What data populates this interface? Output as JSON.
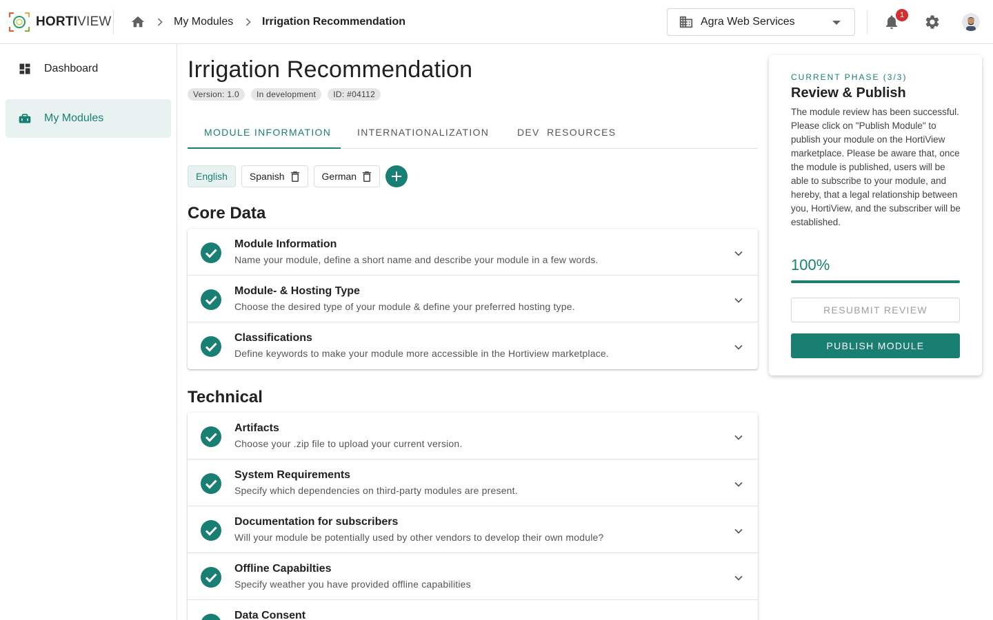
{
  "colors": {
    "accent": "#1a7f73",
    "badge": "#d32f2f"
  },
  "app": {
    "logo_bold": "HORTI",
    "logo_light": "VIEW"
  },
  "breadcrumb": {
    "items": [
      "My Modules",
      "Irrigation Recommendation"
    ]
  },
  "org": {
    "name": "Agra Web Services"
  },
  "notifications": {
    "count": "1"
  },
  "sidebar": {
    "items": [
      {
        "label": "Dashboard",
        "icon": "dashboard-icon"
      },
      {
        "label": "My Modules",
        "icon": "toolbox-icon"
      }
    ]
  },
  "module": {
    "title": "Irrigation Recommendation",
    "version": "Version: 1.0",
    "status": "In development",
    "id": "ID: #04112"
  },
  "tabs": [
    "MODULE INFORMATION",
    "INTERNATIONALIZATION",
    "DEV  RESOURCES"
  ],
  "languages": [
    "English",
    "Spanish",
    "German"
  ],
  "sections": {
    "core": {
      "title": "Core Data",
      "rows": [
        {
          "title": "Module Information",
          "desc": "Name your module, define a short name and describe your module in a few words."
        },
        {
          "title": "Module- & Hosting Type",
          "desc": "Choose the desired type of your module & define your preferred hosting type."
        },
        {
          "title": "Classifications",
          "desc": "Define keywords to make your module more accessible in the Hortiview marketplace."
        }
      ]
    },
    "technical": {
      "title": "Technical",
      "rows": [
        {
          "title": "Artifacts",
          "desc": "Choose your .zip file to upload your current version."
        },
        {
          "title": "System Requirements",
          "desc": "Specify which dependencies on third-party modules are present."
        },
        {
          "title": "Documentation for subscribers",
          "desc": "Will your module be potentially used by other vendors to develop their own module?"
        },
        {
          "title": "Offline Capabilties",
          "desc": "Specify weather you have provided offline capabilities"
        },
        {
          "title": "Data Consent",
          "desc": ""
        }
      ]
    }
  },
  "phase": {
    "label": "CURRENT PHASE (3/3)",
    "title": "Review & Publish",
    "description": "The module review has been successful. Please click on \"Publish Module\" to publish your module on the HortiView marketplace. Please be aware that, once the module is published, users will be able to subscribe to your module, and hereby, that a legal relationship between you, HortiView, and the subscriber will be established.",
    "progress_text": "100%",
    "progress": 1.0,
    "resubmit_label": "RESUBMIT REVIEW",
    "publish_label": "PUBLISH MODULE"
  }
}
